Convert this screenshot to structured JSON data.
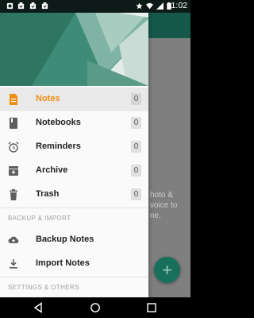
{
  "status_bar": {
    "time": "11:02",
    "left_icons": [
      "notification-icon",
      "notification-icon",
      "notification-icon",
      "notification-icon"
    ],
    "right_icons": [
      "star-icon",
      "wifi-icon",
      "signal-icon",
      "battery-icon"
    ]
  },
  "drawer": {
    "header_colors": [
      "#2d7a67",
      "#86b4a5",
      "#e8eeec"
    ],
    "items": [
      {
        "label": "Notes",
        "count": "0",
        "icon": "notes-icon",
        "active": true
      },
      {
        "label": "Notebooks",
        "count": "0",
        "icon": "notebook-icon"
      },
      {
        "label": "Reminders",
        "count": "0",
        "icon": "alarm-icon"
      },
      {
        "label": "Archive",
        "count": "0",
        "icon": "archive-icon"
      },
      {
        "label": "Trash",
        "count": "0",
        "icon": "trash-icon"
      }
    ],
    "sections": {
      "backup": {
        "title": "BACKUP & IMPORT",
        "items": [
          {
            "label": "Backup Notes",
            "icon": "cloud-upload-icon"
          },
          {
            "label": "Import Notes",
            "icon": "download-icon"
          }
        ]
      },
      "settings": {
        "title": "SETTINGS & OTHERS"
      }
    }
  },
  "background": {
    "hint_line1": "hoto &",
    "hint_line2": "voice to",
    "hint_line3": "ne.",
    "fab_label": "+"
  },
  "colors": {
    "accent": "#ef8d12",
    "primary": "#14594a",
    "status_bar": "#0e1a17"
  }
}
